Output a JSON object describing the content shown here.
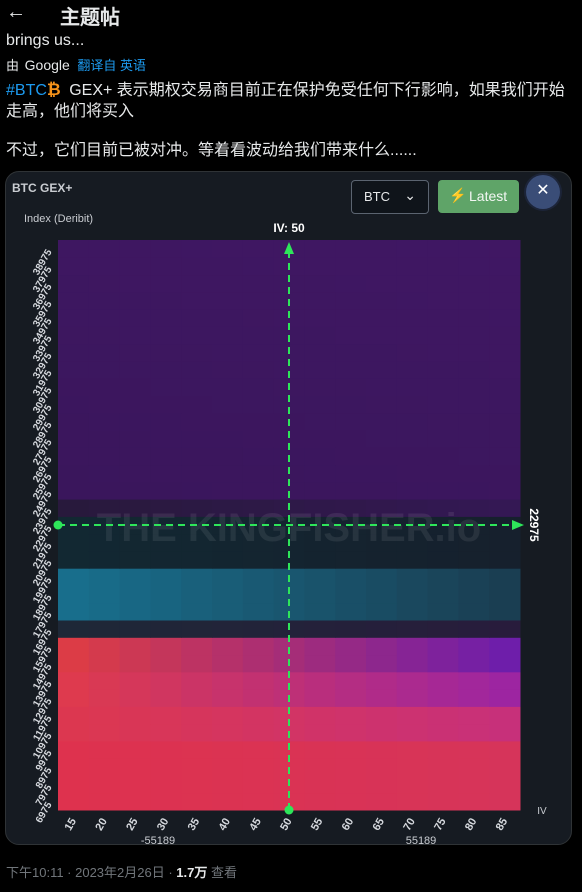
{
  "header": {
    "title": "主题帖",
    "back_icon": "arrow-left-icon"
  },
  "tweet": {
    "prev_line": "brings us...",
    "translate_by": "由",
    "translate_google": "Google",
    "translate_link": "翻译自 英语",
    "hashtag": "#BTC",
    "line1": "GEX+ 表示期权交易商目前正在保护免受任何下行影响，如果我们开始走高，他们将买入",
    "line2": "不过，它们目前已被对冲。等着看波动给我们带来什么......"
  },
  "chart": {
    "title": "BTC GEX+",
    "ylabel": "Index (Deribit)",
    "iv_label": "IV: 50",
    "hline_label": "22975",
    "x_axis_label": "IV",
    "select_value": "BTC",
    "latest_label": "Latest",
    "watermark": "THE KINGFISHER.io",
    "neg_label": "-55189",
    "pos_label": "55189"
  },
  "chart_data": {
    "type": "heatmap",
    "title": "BTC GEX+",
    "ylabel": "Index (Deribit)",
    "xlabel": "IV",
    "x": [
      15,
      20,
      25,
      30,
      35,
      40,
      45,
      50,
      55,
      60,
      65,
      70,
      75,
      80,
      85
    ],
    "y": [
      6975,
      7975,
      8975,
      9975,
      10975,
      11975,
      12975,
      13975,
      14975,
      15975,
      16975,
      17975,
      18975,
      19975,
      20975,
      21975,
      22975,
      23975,
      24975,
      25975,
      26975,
      27975,
      28975,
      29975,
      30975,
      31975,
      32975,
      33975,
      34975,
      35975,
      36975,
      37975,
      38975
    ],
    "colorbar_range": [
      -55189,
      55189
    ],
    "current_iv": 50,
    "current_index": 22975
  },
  "footer": {
    "time": "下午10:11 · 2023年2月26日 · ",
    "views": "1.7万",
    "views_label": " 查看"
  }
}
